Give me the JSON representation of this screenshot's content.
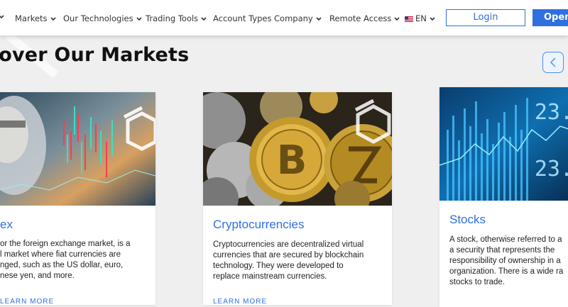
{
  "nav": {
    "items": [
      {
        "label": "Markets",
        "has_dropdown": true
      },
      {
        "label": "Our Technologies",
        "has_dropdown": true
      },
      {
        "label": "Trading Tools",
        "has_dropdown": true
      },
      {
        "label": "Account Types",
        "has_dropdown": false
      },
      {
        "label": "Company",
        "has_dropdown": true
      },
      {
        "label": "Remote Access",
        "has_dropdown": true
      }
    ],
    "language": {
      "label": "EN",
      "icon": "us-flag-icon"
    },
    "login_label": "Login",
    "open_label": "Open"
  },
  "section": {
    "title": "cover Our Markets"
  },
  "cards": [
    {
      "title": "ex",
      "desc": [
        "or the foreign exchange market, is a",
        "l market where fiat currencies are",
        "nged, such as the US dollar, euro,",
        "nese yen, and more."
      ],
      "link": "LEARN MORE"
    },
    {
      "title": "Cryptocurrencies",
      "desc": [
        "Cryptocurrencies are decentralized virtual",
        "currencies that are secured by blockchain",
        "technology. They were developed to",
        "replace mainstream currencies."
      ],
      "link": "LEARN MORE"
    },
    {
      "title": "Stocks",
      "desc": [
        "A stock, otherwise referred to a",
        "a security that represents the",
        "responsibility of ownership in a",
        "organization. There is a wide ra",
        "stocks to trade."
      ],
      "link": ""
    }
  ],
  "colors": {
    "accent": "#2f6fe0",
    "background": "#efefef"
  }
}
